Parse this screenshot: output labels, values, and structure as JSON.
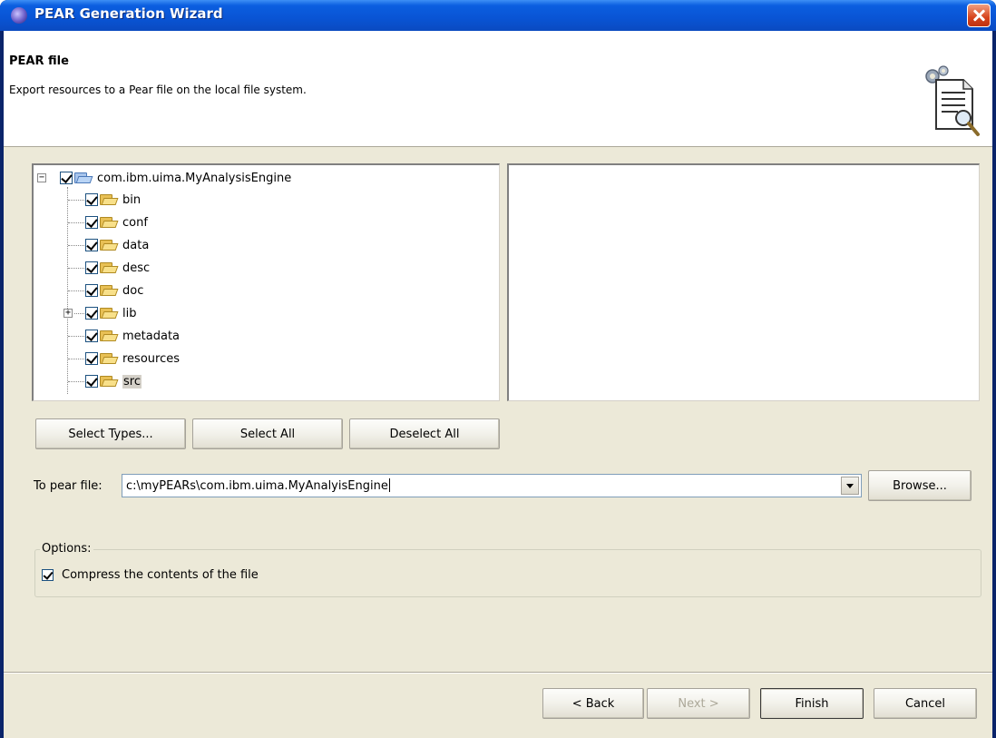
{
  "window": {
    "title": "PEAR Generation Wizard"
  },
  "header": {
    "title": "PEAR file",
    "description": "Export resources to a Pear file on the local file system."
  },
  "tree": {
    "root": {
      "label": "com.ibm.uima.MyAnalysisEngine",
      "expander": "−",
      "checked": true
    },
    "items": [
      {
        "label": "bin",
        "checked": true
      },
      {
        "label": "conf",
        "checked": true
      },
      {
        "label": "data",
        "checked": true
      },
      {
        "label": "desc",
        "checked": true
      },
      {
        "label": "doc",
        "checked": true
      },
      {
        "label": "lib",
        "checked": true,
        "expander": "+"
      },
      {
        "label": "metadata",
        "checked": true
      },
      {
        "label": "resources",
        "checked": true
      },
      {
        "label": "src",
        "checked": true,
        "selected": true
      }
    ]
  },
  "buttons": {
    "select_types": "Select Types...",
    "select_all": "Select All",
    "deselect_all": "Deselect All",
    "browse": "Browse...",
    "back": "< Back",
    "next": "Next >",
    "finish": "Finish",
    "cancel": "Cancel"
  },
  "pear_file": {
    "label": "To pear file:",
    "value": "c:\\myPEARs\\com.ibm.uima.MyAnalyisEngine"
  },
  "options": {
    "title": "Options:",
    "compress_label": "Compress the contents of the file",
    "compress_checked": true
  }
}
